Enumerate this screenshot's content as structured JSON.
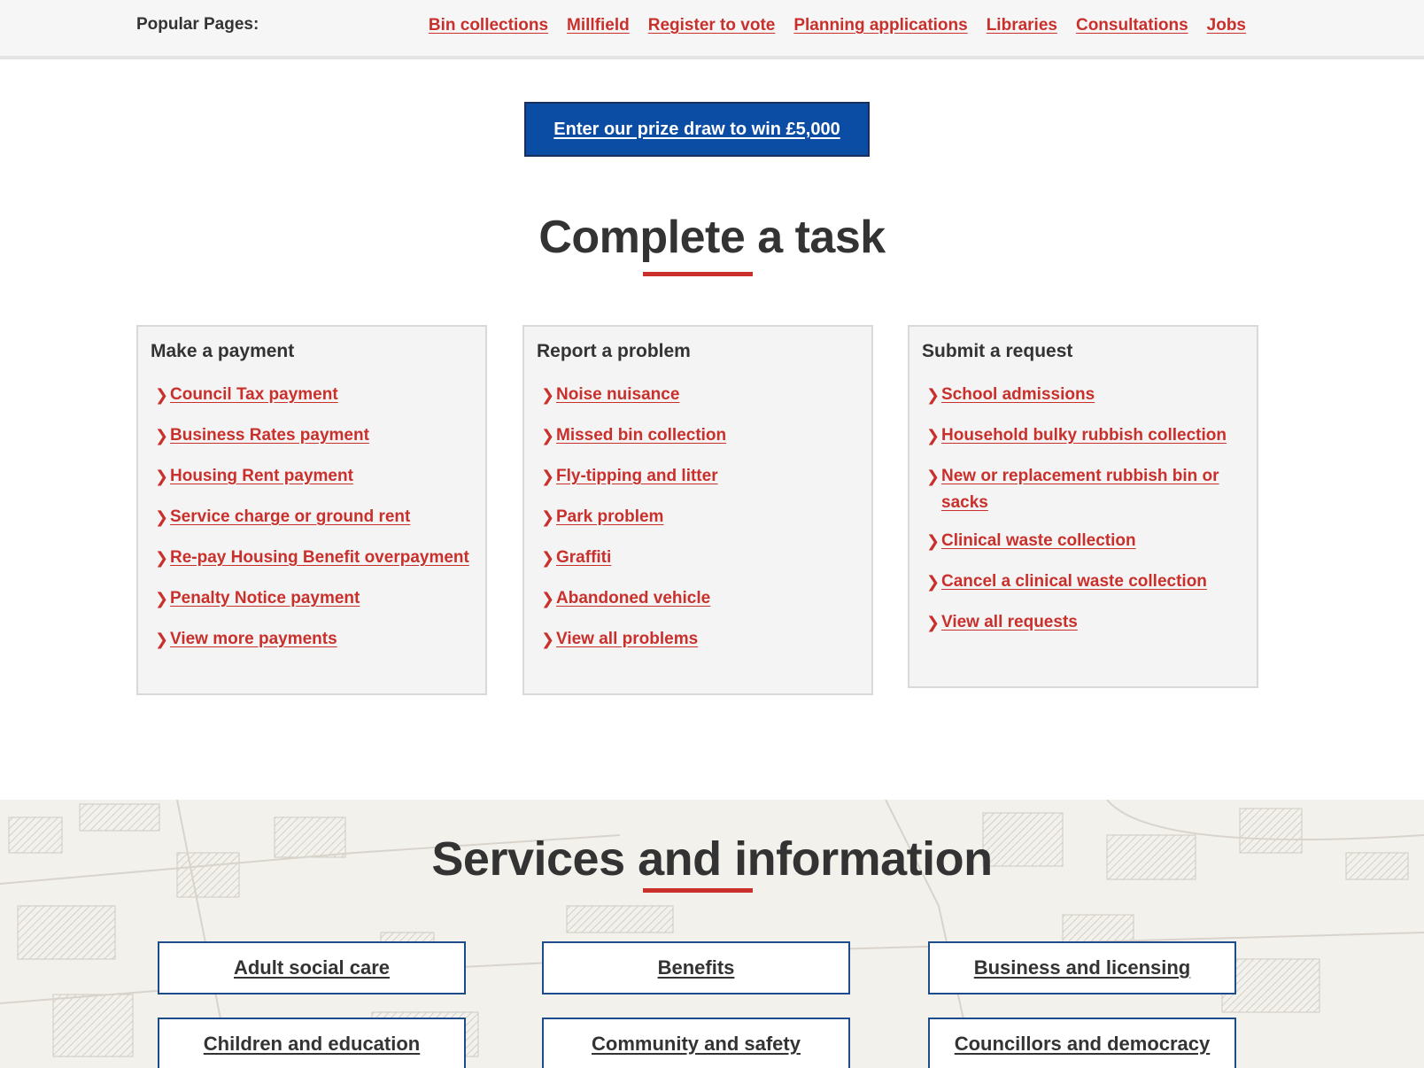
{
  "popular": {
    "label": "Popular Pages:",
    "links": [
      "Bin collections",
      "Millfield",
      "Register to vote",
      "Planning applications",
      "Libraries",
      "Consultations",
      "Jobs"
    ]
  },
  "prize": {
    "label": "Enter our prize draw to win £5,000"
  },
  "tasks": {
    "title": "Complete a task",
    "cards": [
      {
        "heading": "Make a payment",
        "links": [
          "Council Tax payment",
          "Business Rates payment",
          "Housing Rent payment",
          "Service charge or ground rent",
          "Re-pay Housing Benefit overpayment",
          "Penalty Notice payment",
          "View more payments"
        ]
      },
      {
        "heading": "Report a problem",
        "links": [
          "Noise nuisance",
          "Missed bin collection",
          "Fly-tipping and litter",
          "Park problem",
          "Graffiti",
          "Abandoned vehicle",
          "View all problems"
        ]
      },
      {
        "heading": "Submit a request",
        "links": [
          "School admissions",
          "Household bulky rubbish collection",
          "New or replacement rubbish bin or sacks",
          "Clinical waste collection",
          "Cancel a clinical waste collection",
          "View all requests"
        ]
      }
    ]
  },
  "services": {
    "title": "Services and information",
    "items": [
      "Adult social care",
      "Benefits",
      "Business and licensing",
      "Children and education",
      "Community and safety",
      "Councillors and democracy"
    ]
  },
  "colors": {
    "accent_red": "#c9302c",
    "prize_blue": "#0b4ca5",
    "button_border": "#1c4c8c",
    "text_dark": "#333333"
  },
  "icons": {
    "link_bullet": "chevron-right-icon"
  }
}
